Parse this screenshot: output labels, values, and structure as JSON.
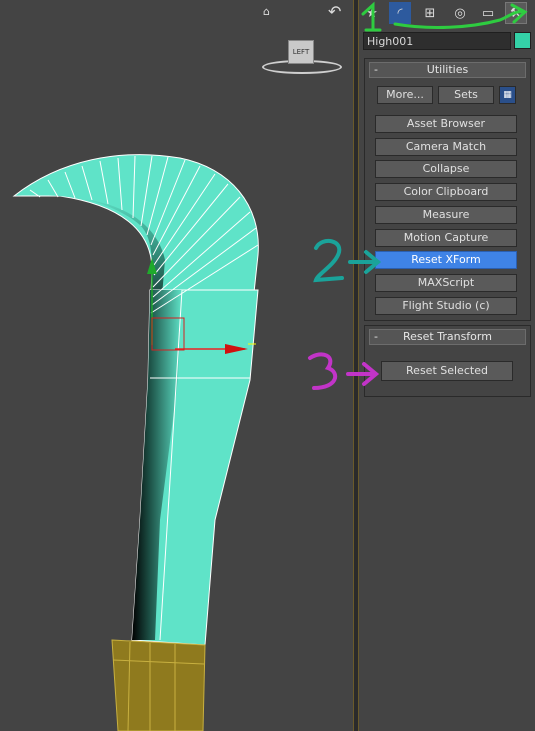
{
  "colors": {
    "viewport_bg": "#444444",
    "object_fill": "#5fe3c8",
    "handle_fill": "#8f7a1e",
    "active_button": "#3f83e6",
    "annotation_1": "#2ecc40",
    "annotation_2": "#1aa39a",
    "annotation_3": "#c234c8"
  },
  "viewport": {
    "viewcube_label": "LEFT",
    "home_icon": "home-icon",
    "orbit_icon": "orbit-arrow-icon"
  },
  "command_panel": {
    "tabs": [
      {
        "name": "create",
        "icon": "star-icon"
      },
      {
        "name": "modify",
        "icon": "modify-curve-icon"
      },
      {
        "name": "hierarchy",
        "icon": "hierarchy-icon"
      },
      {
        "name": "motion",
        "icon": "motion-icon"
      },
      {
        "name": "display",
        "icon": "display-icon"
      },
      {
        "name": "utilities",
        "icon": "hammer-icon"
      }
    ],
    "object_name": "High001",
    "object_color": "#34d2a8"
  },
  "utilities_rollout": {
    "title": "Utilities",
    "toggle": "-",
    "more_label": "More...",
    "sets_label": "Sets",
    "buttons": [
      {
        "label": "Asset Browser"
      },
      {
        "label": "Camera Match"
      },
      {
        "label": "Collapse"
      },
      {
        "label": "Color Clipboard"
      },
      {
        "label": "Measure"
      },
      {
        "label": "Motion Capture"
      },
      {
        "label": "Reset XForm",
        "active": true
      },
      {
        "label": "MAXScript"
      },
      {
        "label": "Flight Studio (c)"
      }
    ]
  },
  "reset_transform_rollout": {
    "title": "Reset Transform",
    "toggle": "-",
    "button_label": "Reset Selected"
  },
  "annotations": {
    "one": "1",
    "two": "2",
    "three": "3"
  }
}
